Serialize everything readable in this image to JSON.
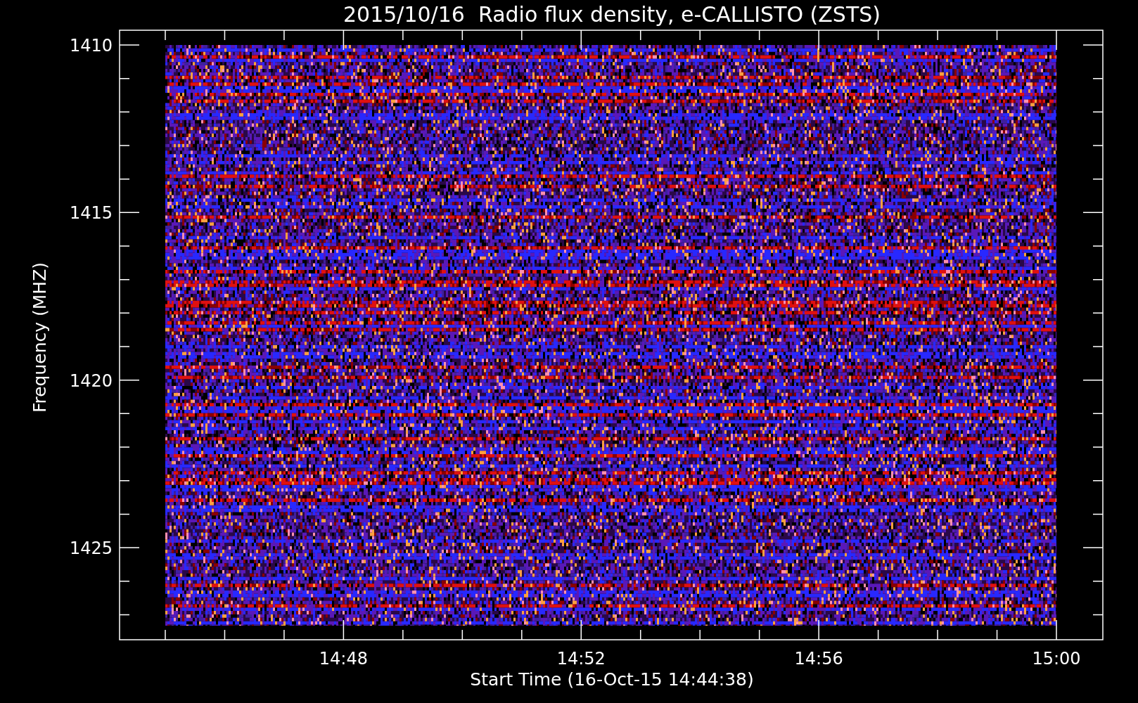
{
  "plot": {
    "title": "2015/10/16  Radio flux density, e-CALLISTO (ZSTS)",
    "ylabel": "Frequency (MHZ)",
    "yticks": [
      "1410",
      "1415",
      "1420",
      "1425"
    ],
    "xticks": [
      "14:48",
      "14:52",
      "14:56",
      "15:00"
    ],
    "xlabel": "Start Time (16-Oct-15 14:44:38)"
  }
}
